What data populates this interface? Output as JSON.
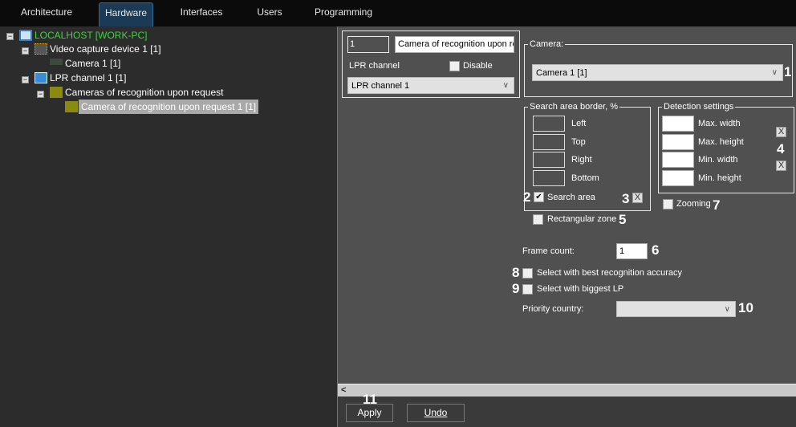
{
  "tabs": [
    "Architecture",
    "Hardware",
    "Interfaces",
    "Users",
    "Programming"
  ],
  "tree": {
    "root": "LOCALHOST [WORK-PC]",
    "video_device": "Video capture device 1 [1]",
    "camera": "Camera 1 [1]",
    "lpr_channel": "LPR channel  1 [1]",
    "cameras_group": "Cameras of recognition upon request",
    "selected_item": "Camera of recognition upon request 1 [1]"
  },
  "header": {
    "id_value": "1",
    "name_value": "Camera of recognition upon re",
    "parent_label": "LPR channel",
    "disable_label": "Disable",
    "parent_select": "LPR channel  1"
  },
  "camera": {
    "group_title": "Camera:",
    "selected": "Camera 1 [1]"
  },
  "search_area": {
    "title": "Search area border, %",
    "fields": [
      "Left",
      "Top",
      "Right",
      "Bottom"
    ],
    "search_area_label": "Search area",
    "search_area_checked": true,
    "rect_zone_label": "Rectangular zone"
  },
  "detection": {
    "title": "Detection settings",
    "fields": [
      "Max. width",
      "Max. height",
      "Min. width",
      "Min. height"
    ],
    "zooming_label": "Zooming"
  },
  "frame_count": {
    "label": "Frame count:",
    "value": "1"
  },
  "best_accuracy_label": "Select with best recognition accuracy",
  "biggest_lp_label": "Select with biggest LP",
  "priority_country": {
    "label": "Priority country:",
    "value": ""
  },
  "callouts": [
    "1",
    "2",
    "3",
    "4",
    "5",
    "6",
    "7",
    "8",
    "9",
    "10",
    "11"
  ],
  "buttons": {
    "apply": "Apply",
    "undo": "Undo"
  },
  "glyphs": {
    "check": "✔",
    "x": "X",
    "chevron": "∨",
    "scroll_left": "<",
    "collapse": "−"
  }
}
